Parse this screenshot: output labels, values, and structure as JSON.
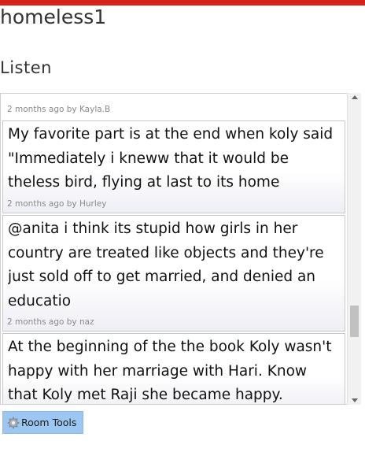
{
  "room": {
    "title": "homeless1"
  },
  "section": {
    "title": "Listen"
  },
  "feed": {
    "top_meta": "2 months ago by Kayla.B",
    "posts": [
      {
        "lines": [
          "My favorite part is at the end when koly said",
          "\"Immediately i kneww that it would be",
          "theless bird, flying at last to its home"
        ],
        "meta": "2 months ago by Hurley"
      },
      {
        "lines": [
          "@anita i think its stupid how girls in her",
          "country are treated like objects and they're",
          "just sold off to get married, and denied an",
          "educatio"
        ],
        "meta": "2 months ago by naz"
      },
      {
        "lines": [
          "At the beginning of the the book Koly wasn't",
          "happy with her marriage with Hari. Know",
          "that Koly met Raji she became happy."
        ],
        "meta": ""
      }
    ]
  },
  "toolbar": {
    "room_tools_label": "Room Tools",
    "room_tools_icon": "gear-icon"
  },
  "colors": {
    "accent_bar": "#d9211b",
    "tools_button_bg": "#9cc7f2"
  }
}
